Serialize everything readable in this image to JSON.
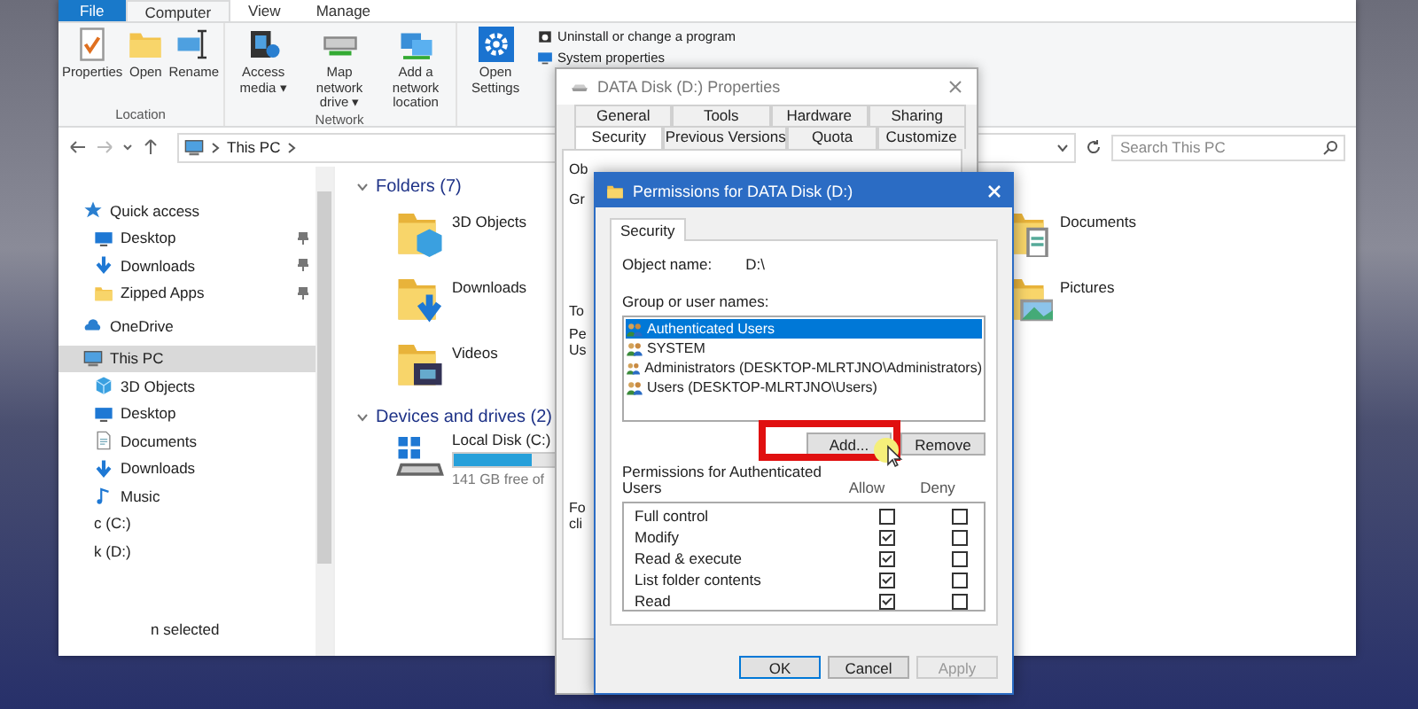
{
  "explorer": {
    "ribbon_tabs": [
      {
        "label": "File",
        "kind": "file",
        "selected": false
      },
      {
        "label": "Computer",
        "kind": "tab",
        "selected": true
      },
      {
        "label": "View",
        "kind": "tab",
        "selected": false
      },
      {
        "label": "Manage",
        "kind": "tab",
        "selected": false
      }
    ],
    "ribbon_groups": [
      {
        "title": "Location",
        "buttons": [
          {
            "label": "Properties"
          },
          {
            "label": "Open"
          },
          {
            "label": "Rename"
          }
        ]
      },
      {
        "title": "Network",
        "buttons": [
          {
            "label": "Access media ▾"
          },
          {
            "label": "Map network drive ▾"
          },
          {
            "label": "Add a network location"
          }
        ]
      },
      {
        "buttons": [
          {
            "label": "Open Settings"
          }
        ],
        "small_buttons": [
          {
            "label": "Uninstall or change a program"
          },
          {
            "label": "System properties"
          }
        ]
      }
    ],
    "address": {
      "location": "This PC"
    },
    "search": {
      "placeholder": "Search This PC"
    },
    "navigation": [
      {
        "label": "Quick access",
        "selected": false,
        "children": [
          {
            "label": "Desktop",
            "pinned": true,
            "selected": false
          },
          {
            "label": "Downloads",
            "pinned": true,
            "selected": false
          },
          {
            "label": "Zipped Apps",
            "pinned": true,
            "selected": false
          }
        ]
      },
      {
        "label": "OneDrive",
        "selected": false
      },
      {
        "label": "This PC",
        "selected": true,
        "children": [
          {
            "label": "3D Objects",
            "selected": false
          },
          {
            "label": "Desktop",
            "selected": false
          },
          {
            "label": "Documents",
            "selected": false
          },
          {
            "label": "Downloads",
            "selected": false
          },
          {
            "label": "Music",
            "selected": false
          },
          {
            "label": "c (C:)",
            "selected": false
          },
          {
            "label": "k (D:)",
            "selected": false
          }
        ]
      }
    ],
    "status_bar": "n selected",
    "folders_heading": "Folders (7)",
    "folders": [
      {
        "name": "3D Objects"
      },
      {
        "name": "Downloads"
      },
      {
        "name": "Videos"
      },
      {
        "name": "Documents"
      },
      {
        "name": "Pictures"
      }
    ],
    "drives_heading": "Devices and drives (2)",
    "drives": [
      {
        "name": "Local Disk (C:)",
        "level": 0.4,
        "free": "141 GB free of"
      }
    ]
  },
  "properties_dialog": {
    "title": "DATA Disk (D:) Properties",
    "tab_rows": [
      [
        {
          "label": "General",
          "selected": false
        },
        {
          "label": "Tools",
          "selected": false
        },
        {
          "label": "Hardware",
          "selected": false
        },
        {
          "label": "Sharing",
          "selected": false
        }
      ],
      [
        {
          "label": "Security",
          "selected": true
        },
        {
          "label": "Previous Versions",
          "selected": false
        },
        {
          "label": "Quota",
          "selected": false
        },
        {
          "label": "Customize",
          "selected": false
        }
      ]
    ],
    "fragments": [
      "Ob",
      "Gr",
      "To",
      "Pe",
      "Us",
      "Fo",
      "cli"
    ]
  },
  "permissions_dialog": {
    "title": "Permissions for DATA Disk (D:)",
    "tab": "Security",
    "object_label": "Object name:",
    "object_value": "D:\\",
    "group_label": "Group or user names:",
    "users": [
      {
        "name": "Authenticated Users",
        "selected": true
      },
      {
        "name": "SYSTEM",
        "selected": false
      },
      {
        "name": "Administrators (DESKTOP-MLRTJNO\\Administrators)",
        "selected": false
      },
      {
        "name": "Users (DESKTOP-MLRTJNO\\Users)",
        "selected": false
      }
    ],
    "add_button": "Add...",
    "remove_button": "Remove",
    "permissions_label": "Permissions for Authenticated Users",
    "allow_header": "Allow",
    "deny_header": "Deny",
    "permissions": [
      {
        "name": "Full control",
        "allow": false,
        "deny": false
      },
      {
        "name": "Modify",
        "allow": true,
        "deny": false
      },
      {
        "name": "Read & execute",
        "allow": true,
        "deny": false
      },
      {
        "name": "List folder contents",
        "allow": true,
        "deny": false
      },
      {
        "name": "Read",
        "allow": true,
        "deny": false
      }
    ],
    "buttons": [
      {
        "label": "OK",
        "kind": "default",
        "disabled": false
      },
      {
        "label": "Cancel",
        "kind": "normal",
        "disabled": false
      },
      {
        "label": "Apply",
        "kind": "normal",
        "disabled": true
      }
    ]
  }
}
